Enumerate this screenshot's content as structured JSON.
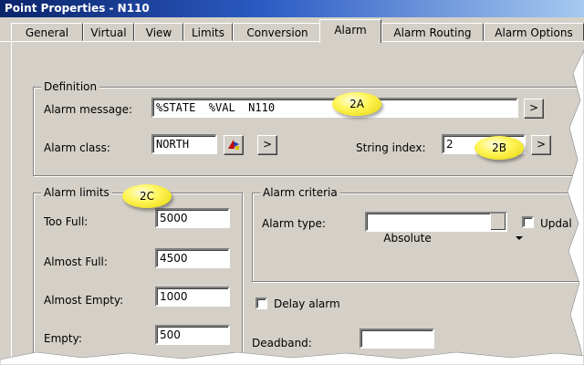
{
  "window": {
    "title": "Point Properties - N110"
  },
  "tabs": [
    {
      "label": "General"
    },
    {
      "label": "Virtual"
    },
    {
      "label": "View"
    },
    {
      "label": "Limits"
    },
    {
      "label": "Conversion"
    },
    {
      "label": "Alarm"
    },
    {
      "label": "Alarm Routing"
    },
    {
      "label": "Alarm Options"
    }
  ],
  "active_tab": "Alarm",
  "definition": {
    "legend": "Definition",
    "alarm_message_label": "Alarm message:",
    "alarm_message_value": "%STATE  %VAL  N110",
    "alarm_class_label": "Alarm class:",
    "alarm_class_value": "NORTH",
    "string_index_label": "String index:",
    "string_index_value": "2",
    "browse_button": ">"
  },
  "alarm_limits": {
    "legend": "Alarm limits",
    "rows": [
      {
        "label": "Too Full:",
        "value": "5000"
      },
      {
        "label": "Almost Full:",
        "value": "4500"
      },
      {
        "label": "Almost Empty:",
        "value": "1000"
      },
      {
        "label": "Empty:",
        "value": "500"
      }
    ]
  },
  "alarm_criteria": {
    "legend": "Alarm criteria",
    "alarm_type_label": "Alarm type:",
    "alarm_type_value": "Absolute",
    "update_label": "Updal"
  },
  "delay_alarm_label": "Delay alarm",
  "deadband_label": "Deadband:",
  "deadband_value": "",
  "callouts": {
    "a": "2A",
    "b": "2B",
    "c": "2C"
  },
  "colors": {
    "title_start": "#0a246a",
    "title_end": "#a6caf0",
    "callout": "#fff55a",
    "face": "#d4d0c8"
  }
}
